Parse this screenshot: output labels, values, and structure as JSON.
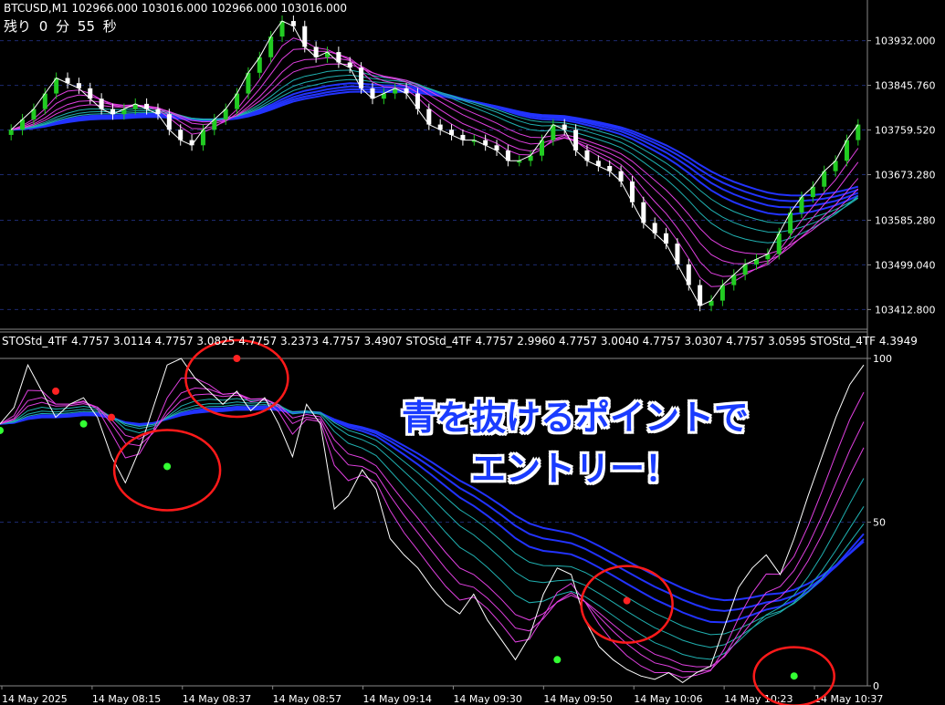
{
  "header": {
    "symbol": "BTCUSD,M1",
    "ohlc": "102966.000 103016.000 102966.000 103016.000"
  },
  "timer": {
    "label_remaining": "残り",
    "minutes": "0",
    "label_minutes": "分",
    "seconds": "55",
    "label_seconds": "秒"
  },
  "indicator_label": "STOStd_4TF 4.7757 3.0114 4.7757 3.0825 4.7757 3.2373 4.7757 3.4907   STOStd_4TF 4.7757 2.9960 4.7757 3.0040 4.7757 3.0307 4.7757 3.0595   STOStd_4TF 4.3949",
  "overlay": {
    "line1": "青を抜けるポイントで",
    "line2": "エントリー！"
  },
  "colors": {
    "background": "#000000",
    "grid": "#1c2a6e",
    "bull_candle": "#22cc22",
    "bear_candle": "#ffffff",
    "ribbon_magenta": "#e040e0",
    "ribbon_teal": "#20b0b0",
    "ribbon_blue": "#2233ff",
    "circle": "#ff1a1a",
    "up_arrow": "#3399ff",
    "down_arrow": "#ff2222"
  },
  "chart_data": [
    {
      "type": "line",
      "title": "BTCUSD,M1",
      "price_axis_ticks": [
        "103932.000",
        "103845.760",
        "103759.520",
        "103673.280",
        "103585.280",
        "103499.040",
        "103412.800"
      ],
      "ylim": [
        103380,
        104000
      ],
      "close": [
        103760,
        103780,
        103800,
        103830,
        103860,
        103850,
        103840,
        103820,
        103800,
        103790,
        103800,
        103810,
        103800,
        103790,
        103760,
        103740,
        103730,
        103760,
        103780,
        103800,
        103830,
        103870,
        103900,
        103940,
        103970,
        103960,
        103920,
        103900,
        103910,
        103890,
        103880,
        103840,
        103820,
        103830,
        103840,
        103830,
        103800,
        103770,
        103760,
        103750,
        103740,
        103740,
        103730,
        103720,
        103700,
        103700,
        103710,
        103740,
        103770,
        103760,
        103720,
        103700,
        103690,
        103680,
        103660,
        103620,
        103580,
        103560,
        103540,
        103500,
        103460,
        103420,
        103430,
        103460,
        103480,
        103500,
        103510,
        103520,
        103560,
        103600,
        103630,
        103650,
        103680,
        103700,
        103740,
        103770
      ]
    },
    {
      "type": "line",
      "title": "STOStd_4TF",
      "y_axis_ticks": [
        "100",
        "50",
        "0"
      ],
      "ylim": [
        0,
        100
      ],
      "stoch": [
        80,
        85,
        98,
        90,
        82,
        86,
        88,
        82,
        70,
        62,
        72,
        85,
        98,
        100,
        94,
        90,
        86,
        90,
        84,
        88,
        80,
        70,
        86,
        80,
        54,
        58,
        66,
        60,
        45,
        40,
        36,
        30,
        25,
        22,
        28,
        20,
        14,
        8,
        15,
        28,
        36,
        34,
        20,
        12,
        8,
        5,
        3,
        2,
        4,
        1,
        4,
        6,
        18,
        30,
        36,
        40,
        34,
        45,
        58,
        70,
        82,
        92,
        98
      ],
      "entry_points_green": [
        {
          "x": 0,
          "y": 78
        },
        {
          "x": 6,
          "y": 80
        },
        {
          "x": 12,
          "y": 67
        },
        {
          "x": 40,
          "y": 8
        },
        {
          "x": 57,
          "y": 3
        }
      ],
      "signal_points_red": [
        {
          "x": 4,
          "y": 90
        },
        {
          "x": 8,
          "y": 82
        },
        {
          "x": 17,
          "y": 100
        },
        {
          "x": 45,
          "y": 26
        }
      ]
    }
  ],
  "time_axis": [
    "14 May 2025",
    "14 May 08:15",
    "14 May 08:37",
    "14 May 08:57",
    "14 May 09:14",
    "14 May 09:30",
    "14 May 09:50",
    "14 May 10:06",
    "14 May 10:23",
    "14 May 10:37"
  ]
}
